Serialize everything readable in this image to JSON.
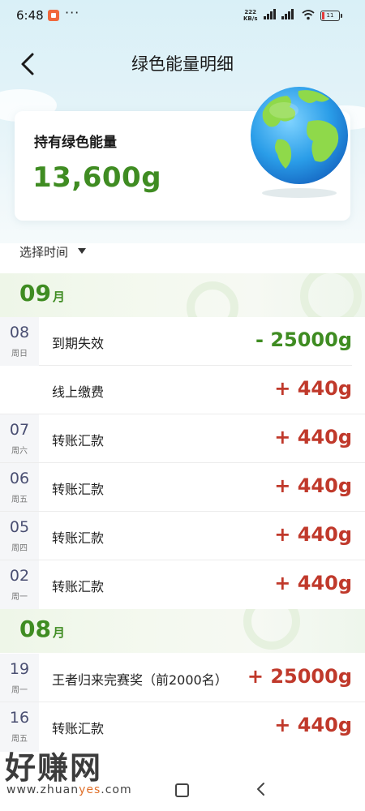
{
  "status_bar": {
    "time": "6:48",
    "more_dots": "···",
    "net_speed_value": "222",
    "net_speed_unit": "KB/s",
    "battery_level": "11"
  },
  "header": {
    "title": "绿色能量明细"
  },
  "balance_card": {
    "label": "持有绿色能量",
    "value": "13,600g"
  },
  "filter": {
    "label": "选择时间"
  },
  "months": [
    {
      "month_num": "09",
      "month_unit": "月",
      "entries": [
        {
          "day": "08",
          "weekday": "周日",
          "label": "到期失效",
          "amount": "- 25000g",
          "type": "negative"
        },
        {
          "day": "",
          "weekday": "",
          "label": "线上缴费",
          "amount": "+ 440g",
          "type": "positive"
        },
        {
          "day": "07",
          "weekday": "周六",
          "label": "转账汇款",
          "amount": "+ 440g",
          "type": "positive"
        },
        {
          "day": "06",
          "weekday": "周五",
          "label": "转账汇款",
          "amount": "+ 440g",
          "type": "positive"
        },
        {
          "day": "05",
          "weekday": "周四",
          "label": "转账汇款",
          "amount": "+ 440g",
          "type": "positive"
        },
        {
          "day": "02",
          "weekday": "周一",
          "label": "转账汇款",
          "amount": "+ 440g",
          "type": "positive"
        }
      ]
    },
    {
      "month_num": "08",
      "month_unit": "月",
      "entries": [
        {
          "day": "19",
          "weekday": "周一",
          "label": "王者归来完赛奖（前2000名）",
          "amount": "+ 25000g",
          "type": "positive"
        },
        {
          "day": "16",
          "weekday": "周五",
          "label": "转账汇款",
          "amount": "+ 440g",
          "type": "positive"
        }
      ]
    }
  ],
  "watermark": {
    "text": "好赚网",
    "url_prefix": "www.zhuan",
    "url_highlight": "yes",
    "url_suffix": ".com"
  },
  "colors": {
    "green": "#3f8c22",
    "red": "#c0392b",
    "date": "#4a4f72"
  }
}
